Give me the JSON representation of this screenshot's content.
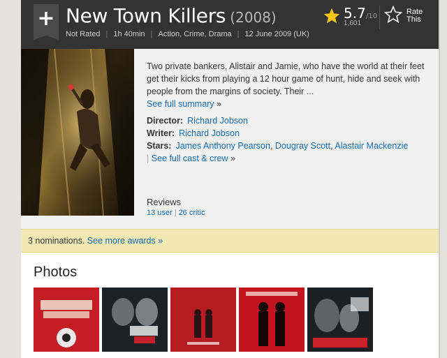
{
  "header": {
    "add_symbol": "+",
    "title": "New Town Killers",
    "year": "(2008)",
    "meta": [
      "Not Rated",
      "1h 40min",
      "Action, Crime, Drama",
      "12 June 2009 (UK)"
    ],
    "rating": {
      "value": "5.7",
      "max": "/10",
      "count": "1,601"
    },
    "rate_label": "Rate This"
  },
  "summary": {
    "text": "Two private bankers, Alistair and Jamie, who have the world at their feet get their kicks from playing a 12 hour game of hunt, hide and seek with people from the margins of society. Their ...",
    "link": "See full summary",
    "link_arrow": "»"
  },
  "credits": {
    "director_label": "Director:",
    "director": "Richard Jobson",
    "writer_label": "Writer:",
    "writer": "Richard Jobson",
    "stars_label": "Stars:",
    "stars": [
      "James Anthony Pearson",
      "Dougray Scott",
      "Alastair Mackenzie"
    ],
    "full_cast_link": "See full cast & crew",
    "full_cast_arrow": "»",
    "sep_comma": ",",
    "sep_bar": "|"
  },
  "reviews": {
    "title": "Reviews",
    "user": "13 user",
    "critic": "26 critic",
    "sep": "|"
  },
  "awards": {
    "text": "3 nominations.",
    "link": "See more awards",
    "arrow": "»"
  },
  "photos": {
    "title": "Photos"
  },
  "colors": {
    "header_bg": "#333333",
    "star": "#f5c518",
    "link": "#136cb2",
    "awards_bg": "#f2e8b4"
  }
}
